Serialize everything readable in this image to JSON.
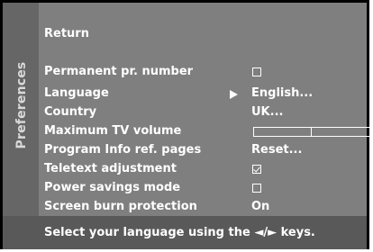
{
  "menu": {
    "side_tab": "Preferences",
    "return_label": "Return",
    "items": [
      {
        "label": "Permanent pr. number",
        "type": "checkbox",
        "checked": false
      },
      {
        "label": "Language",
        "type": "text",
        "value": "English...",
        "selected": true
      },
      {
        "label": "Country",
        "type": "text",
        "value": "UK..."
      },
      {
        "label": "Maximum TV volume",
        "type": "slider",
        "level_fraction": 0.5
      },
      {
        "label": "Program Info ref. pages",
        "type": "text",
        "value": "Reset..."
      },
      {
        "label": "Teletext adjustment",
        "type": "checkbox",
        "checked": true
      },
      {
        "label": "Power savings mode",
        "type": "checkbox",
        "checked": false
      },
      {
        "label": "Screen burn protection",
        "type": "text",
        "value": "On"
      }
    ]
  },
  "status": {
    "prefix": "Select your language using the",
    "keys": "◄/►",
    "suffix": "keys."
  },
  "colors": {
    "panel": "#7f7f7f",
    "side_tab": "#666666",
    "status_bar": "#595959",
    "text": "#ffffff"
  }
}
